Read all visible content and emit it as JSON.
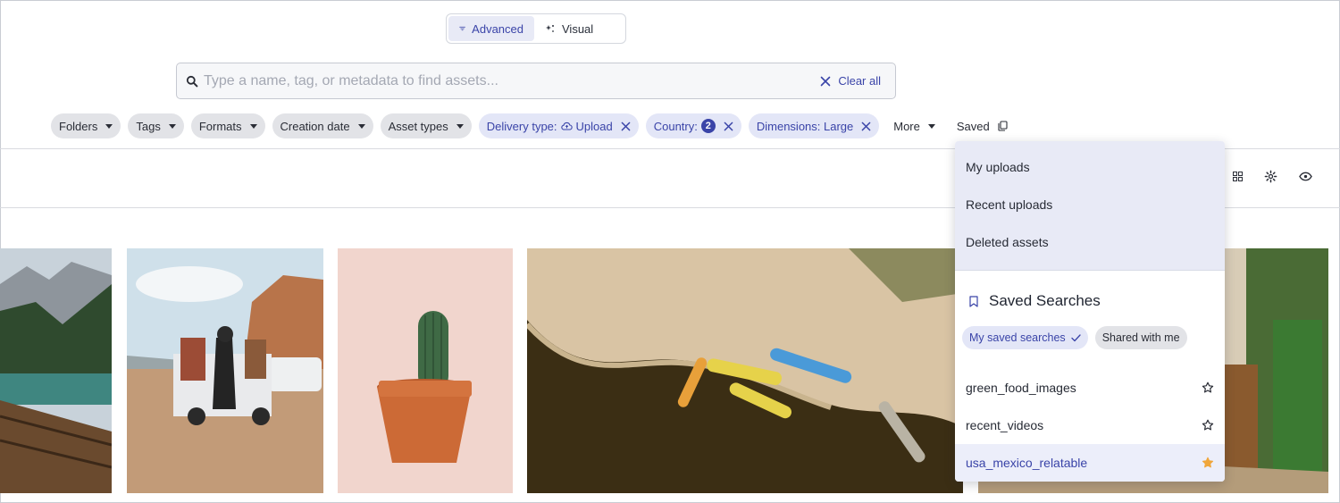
{
  "mode_toggle": {
    "advanced_label": "Advanced",
    "visual_label": "Visual"
  },
  "search": {
    "placeholder": "Type a name, tag, or metadata to find assets...",
    "clear_label": "Clear all"
  },
  "filters": [
    {
      "label": "Folders"
    },
    {
      "label": "Tags"
    },
    {
      "label": "Formats"
    },
    {
      "label": "Creation date"
    },
    {
      "label": "Asset types"
    }
  ],
  "active_filters": {
    "delivery_label": "Delivery type:",
    "delivery_value": "Upload",
    "country_label": "Country:",
    "country_count": "2",
    "dimensions_label": "Dimensions: Large"
  },
  "more_label": "More",
  "saved_label": "Saved",
  "dropdown": {
    "quick_items": [
      "My uploads",
      "Recent uploads",
      "Deleted assets"
    ],
    "saved_searches_title": "Saved Searches",
    "tabs": {
      "mine": "My saved searches",
      "shared": "Shared with me"
    },
    "searches": [
      {
        "name": "green_food_images",
        "starred": false
      },
      {
        "name": "recent_videos",
        "starred": false
      },
      {
        "name": "usa_mexico_relatable",
        "starred": true
      }
    ]
  },
  "colors": {
    "accent": "#3a44a8",
    "chip_active_bg": "#e3e6f7",
    "star_active": "#f0a63b"
  }
}
